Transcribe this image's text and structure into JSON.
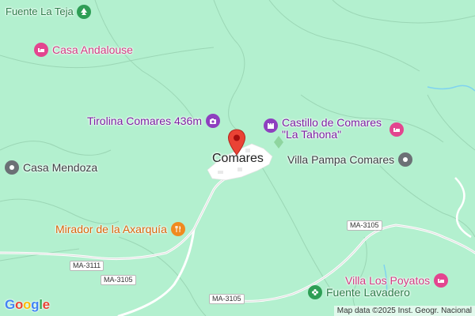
{
  "map": {
    "background_color": "#b3f0cf",
    "town": {
      "label": "Comares"
    },
    "pois": [
      {
        "id": "fuente-la-teja",
        "label": "Fuente La Teja",
        "icon": "tree-icon",
        "color": "#2e7d4a"
      },
      {
        "id": "casa-andalouse",
        "label": "Casa Andalouse",
        "icon": "bed-icon",
        "color": "#e3458f"
      },
      {
        "id": "tirolina",
        "label": "Tirolina Comares 436m",
        "icon": "camera-icon",
        "color": "#7b1fa2"
      },
      {
        "id": "castillo",
        "label": "Castillo de Comares \"La Tahona\"",
        "icon": "castle-icon",
        "color": "#7b1fa2"
      },
      {
        "id": "casa-mendoza",
        "label": "Casa Mendoza",
        "icon": "place-icon",
        "color": "#5f6368"
      },
      {
        "id": "villa-pampa",
        "label": "Villa Pampa Comares",
        "icon": "place-icon",
        "color": "#5f6368"
      },
      {
        "id": "castillo-hotel",
        "label": "",
        "icon": "bed-icon",
        "color": "#e3458f"
      },
      {
        "id": "mirador",
        "label": "Mirador de la Axarquía",
        "icon": "restaurant-icon",
        "color": "#e8710a"
      },
      {
        "id": "villa-los-poyatos",
        "label": "Villa Los Poyatos",
        "icon": "bed-icon",
        "color": "#e3458f"
      },
      {
        "id": "fuente-lavadero",
        "label": "Fuente Lavadero",
        "icon": "flower-icon",
        "color": "#2e7d4a"
      }
    ],
    "roads": [
      "MA-3105",
      "MA-3111",
      "MA-3105",
      "MA-3105"
    ],
    "attribution": "Map data ©2025 Inst. Geogr. Nacional",
    "logo": {
      "letters": [
        "G",
        "o",
        "o",
        "g",
        "l",
        "e"
      ],
      "colors": [
        "#4285f4",
        "#ea4335",
        "#fbbc05",
        "#4285f4",
        "#34a853",
        "#ea4335"
      ]
    }
  }
}
